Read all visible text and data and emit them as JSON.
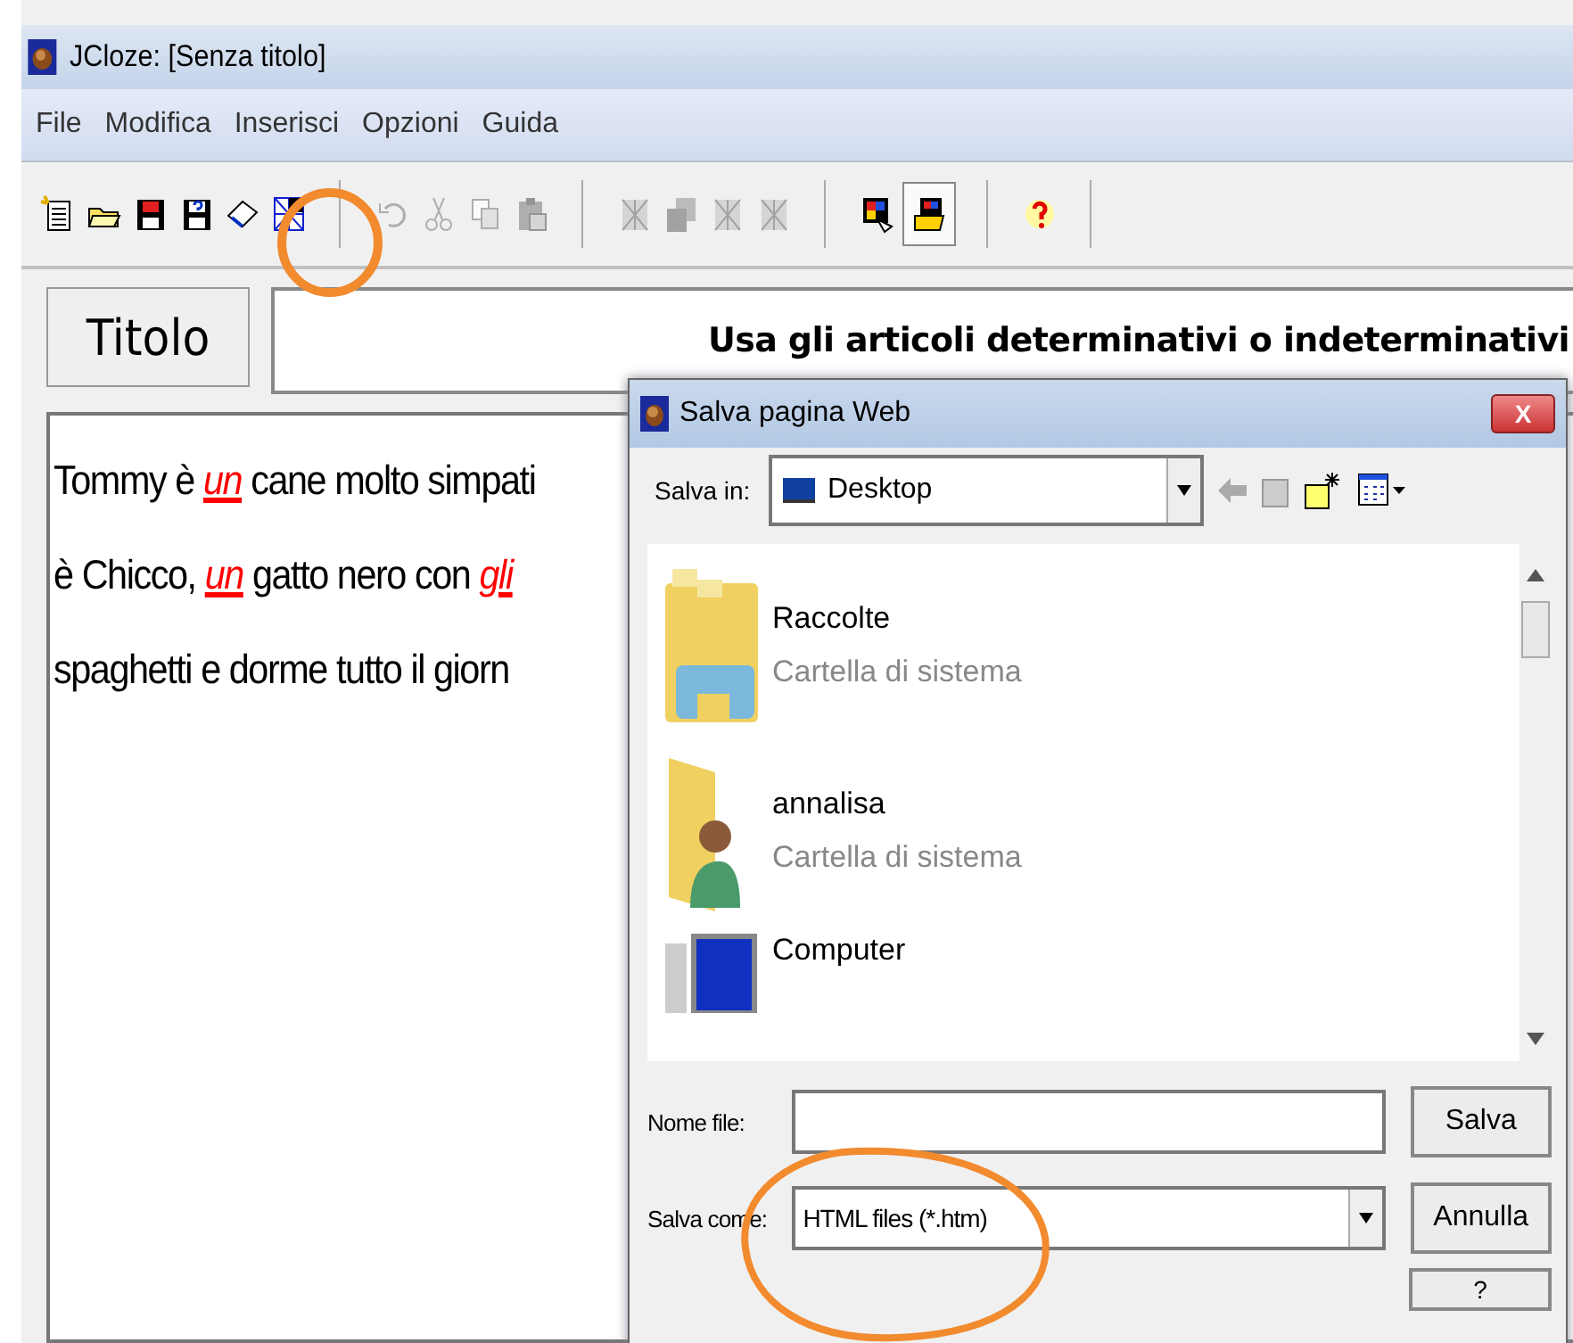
{
  "window": {
    "title": "JCloze: [Senza titolo]"
  },
  "menu": [
    "File",
    "Modifica",
    "Inserisci",
    "Opzioni",
    "Guida"
  ],
  "toolbar": [
    {
      "kind": "new",
      "disabled": false,
      "pressed": false
    },
    {
      "kind": "open",
      "disabled": false,
      "pressed": false
    },
    {
      "kind": "save",
      "disabled": false,
      "pressed": false
    },
    {
      "kind": "saveas",
      "disabled": false,
      "pressed": false
    },
    {
      "kind": "book",
      "disabled": false,
      "pressed": false
    },
    {
      "kind": "web",
      "disabled": false,
      "pressed": false
    },
    {
      "kind": "sep"
    },
    {
      "kind": "undo",
      "disabled": true,
      "pressed": false
    },
    {
      "kind": "cut",
      "disabled": true,
      "pressed": false
    },
    {
      "kind": "copy",
      "disabled": true,
      "pressed": false
    },
    {
      "kind": "paste",
      "disabled": true,
      "pressed": false
    },
    {
      "kind": "sep"
    },
    {
      "kind": "gap",
      "disabled": true,
      "pressed": false
    },
    {
      "kind": "clearall",
      "disabled": true,
      "pressed": false
    },
    {
      "kind": "gap",
      "disabled": true,
      "pressed": false
    },
    {
      "kind": "gapauto",
      "disabled": true,
      "pressed": false
    },
    {
      "kind": "sep"
    },
    {
      "kind": "config",
      "disabled": false,
      "pressed": false
    },
    {
      "kind": "configfolder",
      "disabled": false,
      "pressed": true
    },
    {
      "kind": "sep"
    },
    {
      "kind": "help",
      "disabled": false,
      "pressed": false
    },
    {
      "kind": "sep"
    }
  ],
  "title_button": "Titolo",
  "title_field": {
    "value": "Usa gli articoli determinativi o indeterminativi"
  },
  "text_lines": [
    [
      {
        "text": "Tommy è ",
        "gap": false
      },
      {
        "text": "un",
        "gap": true
      },
      {
        "text": " cane molto simpati",
        "gap": false
      }
    ],
    [
      {
        "text": "è Chicco, ",
        "gap": false
      },
      {
        "text": "un",
        "gap": true
      },
      {
        "text": " gatto nero con ",
        "gap": false
      },
      {
        "text": "gli",
        "gap": true
      }
    ],
    [
      {
        "text": "spaghetti e dorme tutto il giorn",
        "gap": false
      }
    ]
  ],
  "dialog": {
    "title": "Salva pagina Web",
    "close": "X",
    "save_in_label": "Salva in:",
    "save_in_value": "Desktop",
    "items": [
      {
        "kind": "libraries",
        "name": "Raccolte",
        "subtitle": "Cartella di sistema"
      },
      {
        "kind": "user",
        "name": "annalisa",
        "subtitle": "Cartella di sistema"
      },
      {
        "kind": "computer",
        "name": "Computer"
      }
    ],
    "filename_label": "Nome file:",
    "type_label": "Salva come:",
    "type_value": "HTML files (*.htm)",
    "buttons": [
      "Salva",
      "Annulla",
      "?"
    ]
  }
}
